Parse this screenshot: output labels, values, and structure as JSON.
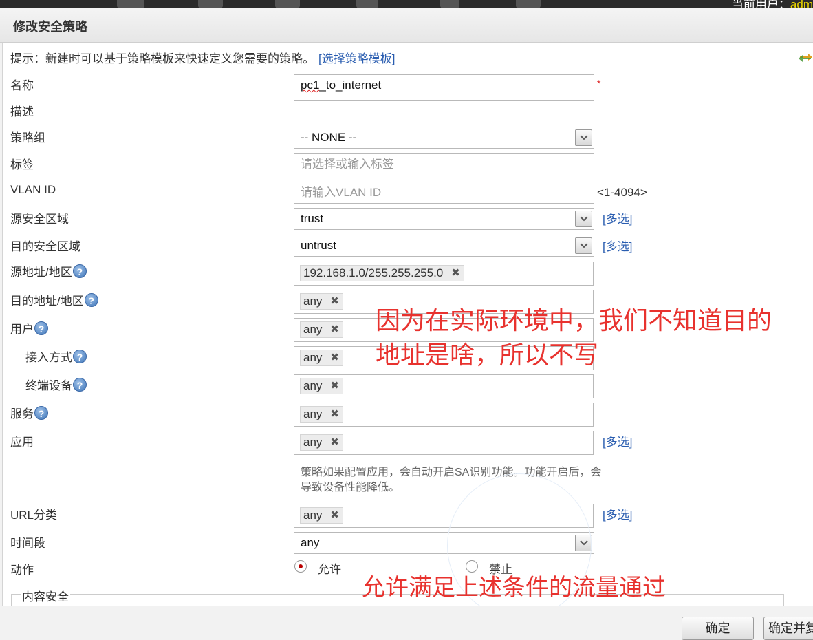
{
  "topbar": {
    "user_prefix": "当前用户：",
    "user_name": "adm"
  },
  "dialog": {
    "title": "修改安全策略"
  },
  "hint": {
    "text": "提示：新建时可以基于策略模板来快速定义您需要的策略。",
    "link": "[选择策略模板]"
  },
  "form": {
    "name": {
      "label": "名称",
      "value_a": "pc1",
      "value_b": "_to_internet",
      "required": "*"
    },
    "description": {
      "label": "描述",
      "value": ""
    },
    "policy_group": {
      "label": "策略组",
      "value": "-- NONE --"
    },
    "tags": {
      "label": "标签",
      "placeholder": "请选择或输入标签"
    },
    "vlan_id": {
      "label": "VLAN ID",
      "placeholder": "请输入VLAN ID",
      "range": "<1-4094>"
    },
    "src_zone": {
      "label": "源安全区域",
      "value": "trust",
      "more": "[多选]"
    },
    "dst_zone": {
      "label": "目的安全区域",
      "value": "untrust",
      "more": "[多选]"
    },
    "src_addr": {
      "label": "源地址/地区",
      "tag": "192.168.1.0/255.255.255.0"
    },
    "dst_addr": {
      "label": "目的地址/地区",
      "tag": "any"
    },
    "user": {
      "label": "用户",
      "tag": "any"
    },
    "access_mode": {
      "label": "接入方式",
      "tag": "any"
    },
    "terminal": {
      "label": "终端设备",
      "tag": "any"
    },
    "service": {
      "label": "服务",
      "tag": "any"
    },
    "application": {
      "label": "应用",
      "tag": "any",
      "more": "[多选]",
      "note": "策略如果配置应用，会自动开启SA识别功能。功能开启后，会导致设备性能降低。"
    },
    "url_category": {
      "label": "URL分类",
      "tag": "any",
      "more": "[多选]"
    },
    "time_range": {
      "label": "时间段",
      "value": "any"
    },
    "action": {
      "label": "动作",
      "allow": "允许",
      "deny": "禁止",
      "selected": "允许"
    },
    "content_security": {
      "legend": "内容安全"
    }
  },
  "annotations": {
    "dst_line1": "因为在实际环境中，我们不知道目的",
    "dst_line2": "地址是啥，所以不写",
    "action_note": "允许满足上述条件的流量通过"
  },
  "buttons": {
    "ok": "确定",
    "ok_and_more": "确定并复制"
  },
  "question_icon_glyph": "?",
  "tag_remove_glyph": "✖",
  "colors": {
    "link": "#2a5db0",
    "annotation": "#e8322e",
    "required": "#dd2222"
  }
}
